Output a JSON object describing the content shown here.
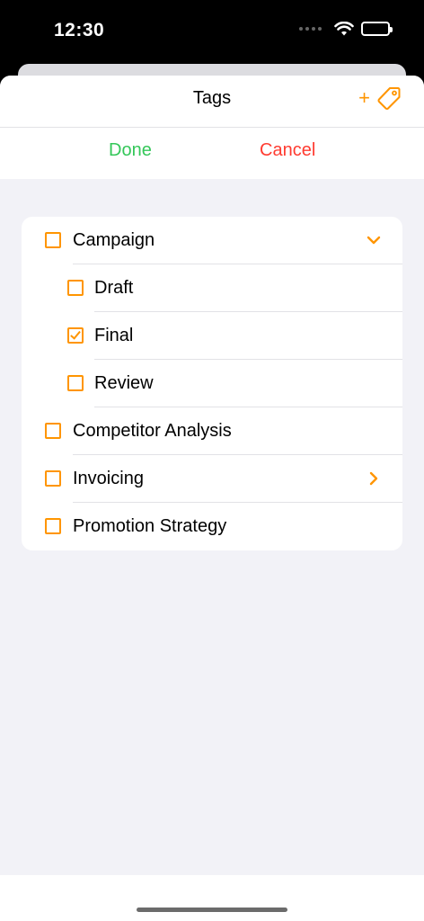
{
  "status_bar": {
    "time": "12:30",
    "icons": [
      "signal-dots-icon",
      "wifi-icon",
      "battery-icon"
    ]
  },
  "nav": {
    "title": "Tags",
    "add_symbol": "+",
    "add_icon": "tag-icon"
  },
  "actions": {
    "done_label": "Done",
    "cancel_label": "Cancel",
    "done_color": "#34c759",
    "cancel_color": "#ff3b30"
  },
  "accent_color": "#ff9500",
  "tags": [
    {
      "label": "Campaign",
      "level": 0,
      "checked": false,
      "disclosure": "chevron-down-icon"
    },
    {
      "label": "Draft",
      "level": 1,
      "checked": false,
      "disclosure": null
    },
    {
      "label": "Final",
      "level": 1,
      "checked": true,
      "disclosure": null
    },
    {
      "label": "Review",
      "level": 1,
      "checked": false,
      "disclosure": null
    },
    {
      "label": "Competitor Analysis",
      "level": 0,
      "checked": false,
      "disclosure": null
    },
    {
      "label": "Invoicing",
      "level": 0,
      "checked": false,
      "disclosure": "chevron-right-icon"
    },
    {
      "label": "Promotion Strategy",
      "level": 0,
      "checked": false,
      "disclosure": null
    }
  ]
}
